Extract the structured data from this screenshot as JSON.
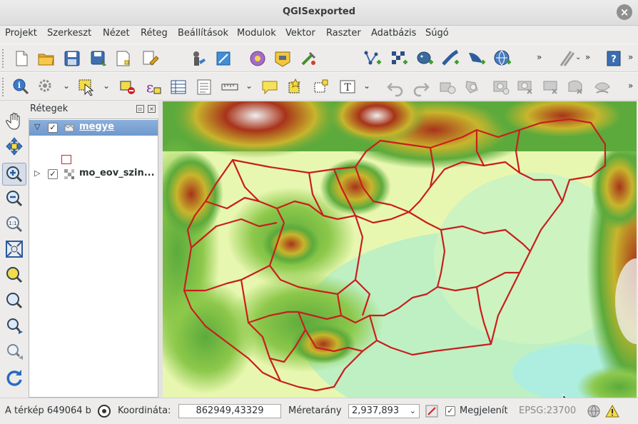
{
  "window": {
    "title": "QGISexported",
    "close_glyph": "×"
  },
  "menubar": {
    "items": [
      "Projekt",
      "Szerkeszt",
      "Nézet",
      "Réteg",
      "Beállítások",
      "Modulok",
      "Vektor",
      "Raszter",
      "Adatbázis",
      "Súgó"
    ]
  },
  "toolbar1": {
    "icons": [
      "new-project-icon",
      "open-project-icon",
      "save-project-icon",
      "save-as-icon",
      "new-print-composer-icon",
      "composer-manager-icon",
      "pan-map-icon",
      "touch-zoom-icon",
      "plugin-manager-icon",
      "python-plugin-icon",
      "processing-tools-icon",
      "add-vector-layer-icon",
      "add-raster-layer-icon",
      "add-postgis-layer-icon",
      "add-spatialite-layer-icon",
      "add-wms-layer-icon",
      "add-wfs-layer-icon"
    ],
    "overflow_glyph": "»"
  },
  "toolbar2": {
    "icons": [
      "identify-icon",
      "run-feature-action-icon",
      "select-features-icon",
      "deselect-features-icon",
      "select-by-expression-icon",
      "attribute-table-icon",
      "statistics-icon",
      "measure-line-icon",
      "map-tips-icon",
      "new-bookmark-icon",
      "show-bookmarks-icon",
      "text-annotation-icon",
      "undo-icon",
      "redo-icon",
      "add-ring-icon",
      "add-part-icon",
      "fill-ring-icon",
      "delete-ring-icon",
      "delete-part-icon",
      "reshape-features-icon",
      "offset-curve-icon"
    ],
    "overflow_glyph": "»"
  },
  "map_tools": [
    "pan-hand-icon",
    "pan-to-selection-icon",
    "zoom-in-icon",
    "zoom-out-icon",
    "zoom-native-icon",
    "zoom-full-icon",
    "zoom-to-selection-icon",
    "zoom-to-layer-icon",
    "zoom-last-icon",
    "zoom-next-icon",
    "refresh-icon"
  ],
  "layers_panel": {
    "title": "Rétegek",
    "layers": [
      {
        "name": "megye",
        "checked": true,
        "expanded": true,
        "selected": true,
        "type": "vector",
        "symbol_color": "#c8282a"
      },
      {
        "name": "mo_eov_szin...",
        "checked": true,
        "expanded": false,
        "selected": false,
        "type": "raster"
      }
    ],
    "expanded_glyph": "▽",
    "collapsed_glyph": "▷",
    "check_glyph": "✓"
  },
  "map": {
    "colors": {
      "lowland": "#bff0c4",
      "plain": "#e8f7b0",
      "hills": "#5caa3c",
      "mid": "#c8b52c",
      "high": "#a8331a",
      "peak": "#eeeeee",
      "boundary": "#c81e1e"
    }
  },
  "statusbar": {
    "scale_text": "A térkép 649064 b",
    "coord_label": "Koordináta:",
    "coord_value": "862949,43329",
    "scale_label": "Méretarány",
    "scale_value": "2,937,893",
    "render_label": "Megjelenít",
    "render_checked": true,
    "crs": "EPSG:23700"
  }
}
